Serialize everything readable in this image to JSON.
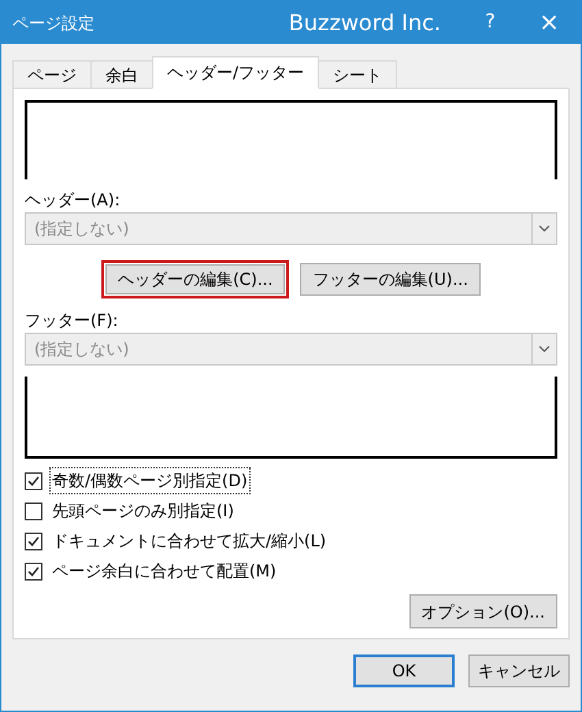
{
  "window": {
    "title": "ページ設定",
    "brand": "Buzzword Inc.",
    "help": "?",
    "close": "×"
  },
  "tabs": [
    {
      "label": "ページ",
      "selected": false
    },
    {
      "label": "余白",
      "selected": false
    },
    {
      "label": "ヘッダー/フッター",
      "selected": true
    },
    {
      "label": "シート",
      "selected": false
    }
  ],
  "header": {
    "label": "ヘッダー(A):",
    "value": "(指定しない)",
    "disabled": true
  },
  "edit_buttons": [
    {
      "label": "ヘッダーの編集(C)...",
      "highlighted": true
    },
    {
      "label": "フッターの編集(U)...",
      "highlighted": false
    }
  ],
  "footer": {
    "label": "フッター(F):",
    "value": "(指定しない)",
    "disabled": true
  },
  "options": [
    {
      "label": "奇数/偶数ページ別指定(D)",
      "checked": true,
      "focused": true
    },
    {
      "label": "先頭ページのみ別指定(I)",
      "checked": false,
      "focused": false
    },
    {
      "label": "ドキュメントに合わせて拡大/縮小(L)",
      "checked": true,
      "focused": false
    },
    {
      "label": "ページ余白に合わせて配置(M)",
      "checked": true,
      "focused": false
    }
  ],
  "options_button": "オプション(O)...",
  "buttons": [
    {
      "label": "OK",
      "kind": "default"
    },
    {
      "label": "キャンセル",
      "kind": "normal"
    }
  ]
}
